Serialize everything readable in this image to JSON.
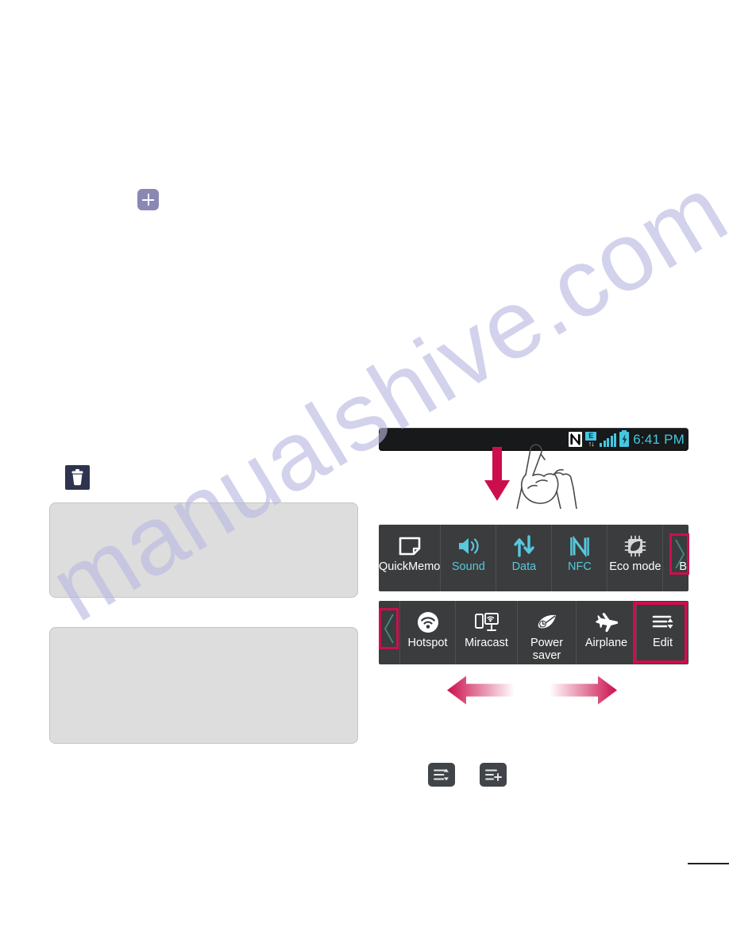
{
  "page": {
    "background": "#ffffff",
    "watermark_text": "manualshive.com",
    "watermark_color": "#b9b8e2"
  },
  "colors": {
    "accent_crimson": "#cc0f4c",
    "panel_dark": "#3a3c3d",
    "status_bar_dark": "#17191a",
    "toggle_cyan": "#57c8de",
    "status_cyan": "#45c7e0",
    "badge_purple": "#8b88b4",
    "trash_navy": "#2e3350",
    "gray_box": "#dddddd",
    "chip_gray": "#414549"
  },
  "left_column": {
    "add_badge": {
      "icon": "plus-icon",
      "label": ""
    },
    "delete_badge": {
      "icon": "trash-icon",
      "label": ""
    },
    "note_boxes": [
      {
        "text": ""
      },
      {
        "text": ""
      }
    ]
  },
  "phone": {
    "status_bar": {
      "time": "6:41 PM",
      "icons": [
        {
          "name": "nfc-icon",
          "glyph": "N"
        },
        {
          "name": "edge-data-icon",
          "glyph": "E",
          "arrows": "↑↓"
        },
        {
          "name": "signal-bars-icon",
          "bars": 5
        },
        {
          "name": "battery-charging-icon"
        }
      ]
    },
    "gesture": {
      "swipe_down": "swipe-down-arrow",
      "hand": "hand-pointing-icon"
    },
    "quick_settings": {
      "row1": [
        {
          "label": "QuickMemo",
          "icon": "quickmemo-icon",
          "state": "off"
        },
        {
          "label": "Sound",
          "icon": "sound-icon",
          "state": "on"
        },
        {
          "label": "Data",
          "icon": "data-icon",
          "state": "on"
        },
        {
          "label": "NFC",
          "icon": "nfc-icon",
          "state": "on"
        },
        {
          "label": "Eco mode",
          "icon": "eco-mode-icon",
          "state": "off"
        },
        {
          "label": "B",
          "icon": "bluetooth-icon",
          "state": "off"
        }
      ],
      "row2": [
        {
          "label": "Hotspot",
          "icon": "hotspot-icon",
          "state": "off"
        },
        {
          "label": "Miracast",
          "icon": "miracast-icon",
          "state": "off"
        },
        {
          "label": "Power\nsaver",
          "icon": "power-saver-icon",
          "state": "off"
        },
        {
          "label": "Airplane",
          "icon": "airplane-icon",
          "state": "off"
        },
        {
          "label": "Edit",
          "icon": "edit-icon",
          "state": "off"
        }
      ],
      "scroll_hints": {
        "right_chevron": "›",
        "left_chevron": "‹"
      }
    },
    "swipe_hints": {
      "left_arrow": "swipe-left-arrow",
      "right_arrow": "swipe-right-arrow"
    }
  },
  "bottom_icons": [
    {
      "name": "reorder-toggles-icon",
      "label": ""
    },
    {
      "name": "add-toggle-icon",
      "label": ""
    }
  ]
}
